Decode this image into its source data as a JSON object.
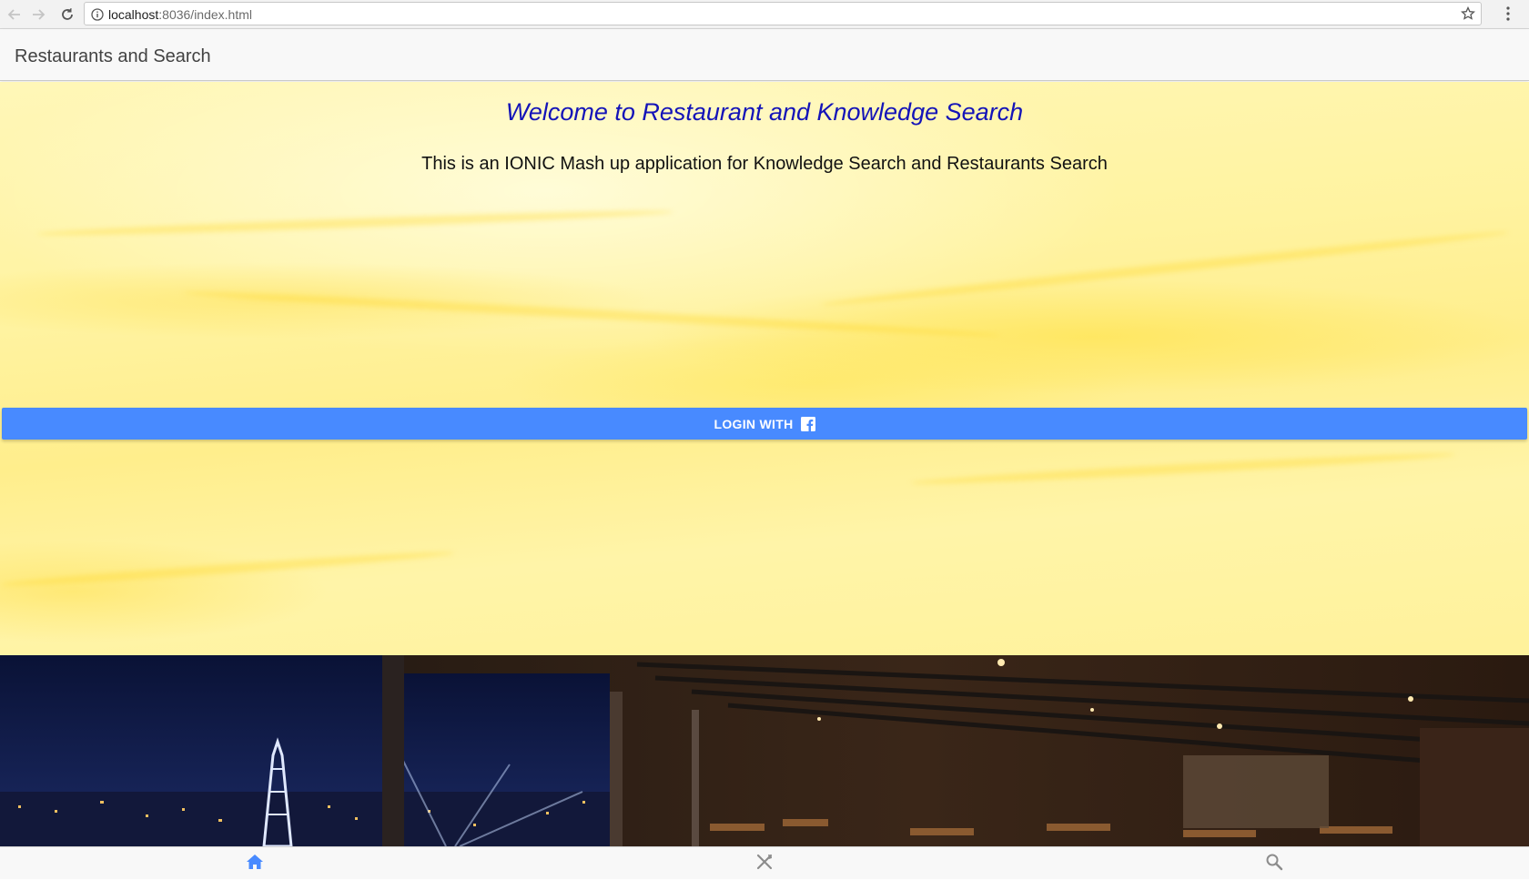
{
  "browser": {
    "url_host": "localhost",
    "url_path": ":8036/index.html",
    "icons": [
      "back-arrow-icon",
      "forward-arrow-icon",
      "reload-icon",
      "info-icon",
      "star-icon",
      "kebab-menu-icon"
    ]
  },
  "toolbar": {
    "title": "Restaurants and Search"
  },
  "main": {
    "welcome": "Welcome to Restaurant and Knowledge Search",
    "subtitle": "This is an IONIC Mash up application for Knowledge Search and Restaurants Search",
    "login_label": "LOGIN WITH",
    "login_icon": "facebook-icon"
  },
  "tabs": [
    {
      "name": "home",
      "icon": "home-icon",
      "active": true
    },
    {
      "name": "restaurants",
      "icon": "fork-knife-icon",
      "active": false
    },
    {
      "name": "search",
      "icon": "search-icon",
      "active": false
    }
  ],
  "colors": {
    "accent": "#488aff",
    "welcome_text": "#1414b8",
    "background": "#fff4a8",
    "inactive_icon": "#8c8c8c"
  }
}
